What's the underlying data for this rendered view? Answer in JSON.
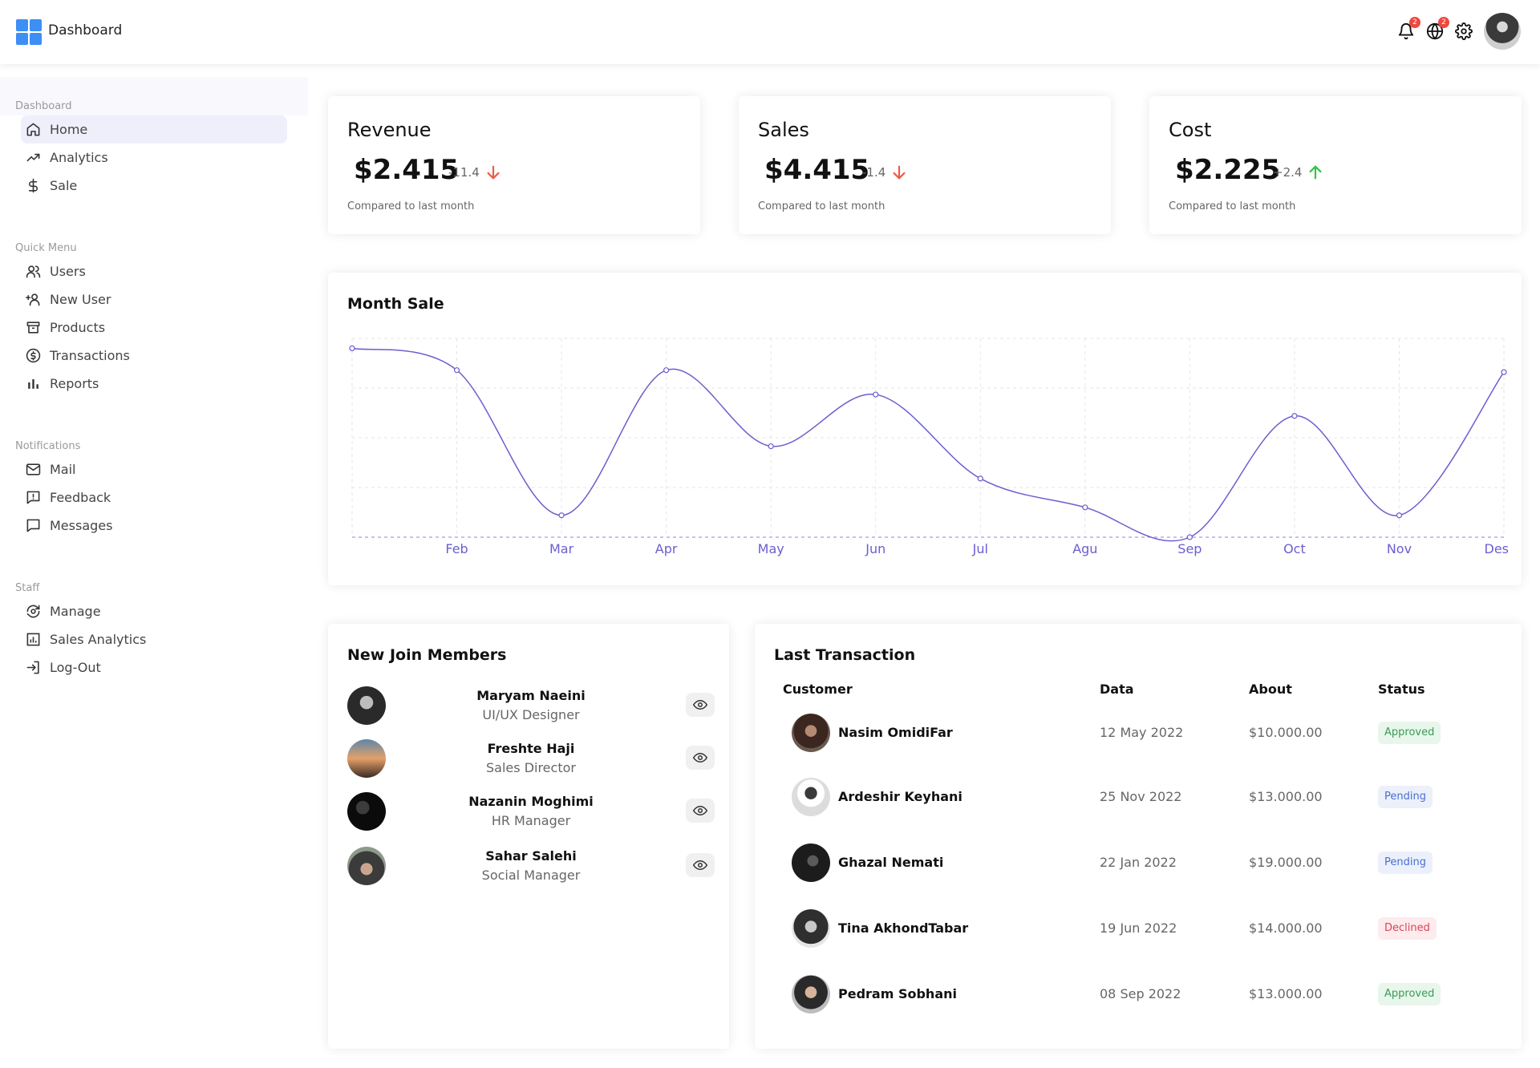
{
  "app": {
    "title": "Dashboard"
  },
  "topbar": {
    "notifications_badge": "2",
    "language_badge": "2",
    "icons": [
      "bell-icon",
      "globe-icon",
      "gear-icon"
    ]
  },
  "sidebar": {
    "sections": [
      {
        "title": "Dashboard",
        "items": [
          {
            "label": "Home",
            "icon": "home-icon",
            "active": true
          },
          {
            "label": "Analytics",
            "icon": "trend-icon"
          },
          {
            "label": "Sale",
            "icon": "dollar-icon"
          }
        ]
      },
      {
        "title": "Quick Menu",
        "items": [
          {
            "label": "Users",
            "icon": "users-icon"
          },
          {
            "label": "New User",
            "icon": "add-user-icon"
          },
          {
            "label": "Products",
            "icon": "archive-icon"
          },
          {
            "label": "Transactions",
            "icon": "coin-icon"
          },
          {
            "label": "Reports",
            "icon": "bar-chart-icon"
          }
        ]
      },
      {
        "title": "Notifications",
        "items": [
          {
            "label": "Mail",
            "icon": "mail-icon"
          },
          {
            "label": "Feedback",
            "icon": "feedback-icon"
          },
          {
            "label": "Messages",
            "icon": "message-icon"
          }
        ]
      },
      {
        "title": "Staff",
        "items": [
          {
            "label": "Manage",
            "icon": "manage-icon"
          },
          {
            "label": "Sales Analytics",
            "icon": "analytics-icon"
          },
          {
            "label": "Log-Out",
            "icon": "logout-icon"
          }
        ]
      }
    ]
  },
  "kpis": [
    {
      "title": "Revenue",
      "value": "$2.415",
      "delta": "-11.4",
      "direction": "down",
      "sub": "Compared to last month"
    },
    {
      "title": "Sales",
      "value": "$4.415",
      "delta": "-1.4",
      "direction": "down",
      "sub": "Compared to last month"
    },
    {
      "title": "Cost",
      "value": "$2.225",
      "delta": "+2.4",
      "direction": "up",
      "sub": "Compared to last month"
    }
  ],
  "colors": {
    "line": "#6a5fcf",
    "down": "#ee5b46",
    "up": "#2fc34a",
    "accent": "#3d8ff5"
  },
  "chart_data": {
    "type": "line",
    "title": "Month Sale",
    "x": [
      "",
      "Feb",
      "Mar",
      "Apr",
      "May",
      "Jun",
      "Jul",
      "Agu",
      "Sep",
      "Oct",
      "Nov",
      "Des"
    ],
    "values": [
      3800,
      3360,
      440,
      3360,
      1830,
      2870,
      1180,
      600,
      0,
      2440,
      440,
      3320
    ],
    "ylim": [
      0,
      4000
    ],
    "grid": true,
    "xlabel": "",
    "ylabel": ""
  },
  "members": {
    "title": "New Join Members",
    "items": [
      {
        "name": "Maryam Naeini",
        "role": "UI/UX Designer"
      },
      {
        "name": "Freshte Haji",
        "role": "Sales Director"
      },
      {
        "name": "Nazanin Moghimi",
        "role": "HR Manager"
      },
      {
        "name": "Sahar Salehi",
        "role": "Social Manager"
      }
    ]
  },
  "transactions": {
    "title": "Last Transaction",
    "columns": [
      "Customer",
      "Data",
      "About",
      "Status"
    ],
    "rows": [
      {
        "customer": "Nasim OmidiFar",
        "date": "12 May 2022",
        "amount": "$10.000.00",
        "status": "Approved"
      },
      {
        "customer": "Ardeshir Keyhani",
        "date": "25 Nov 2022",
        "amount": "$13.000.00",
        "status": "Pending"
      },
      {
        "customer": "Ghazal Nemati",
        "date": "22 Jan 2022",
        "amount": "$19.000.00",
        "status": "Pending"
      },
      {
        "customer": "Tina AkhondTabar",
        "date": "19 Jun 2022",
        "amount": "$14.000.00",
        "status": "Declined"
      },
      {
        "customer": "Pedram Sobhani",
        "date": "08 Sep 2022",
        "amount": "$13.000.00",
        "status": "Approved"
      }
    ]
  }
}
